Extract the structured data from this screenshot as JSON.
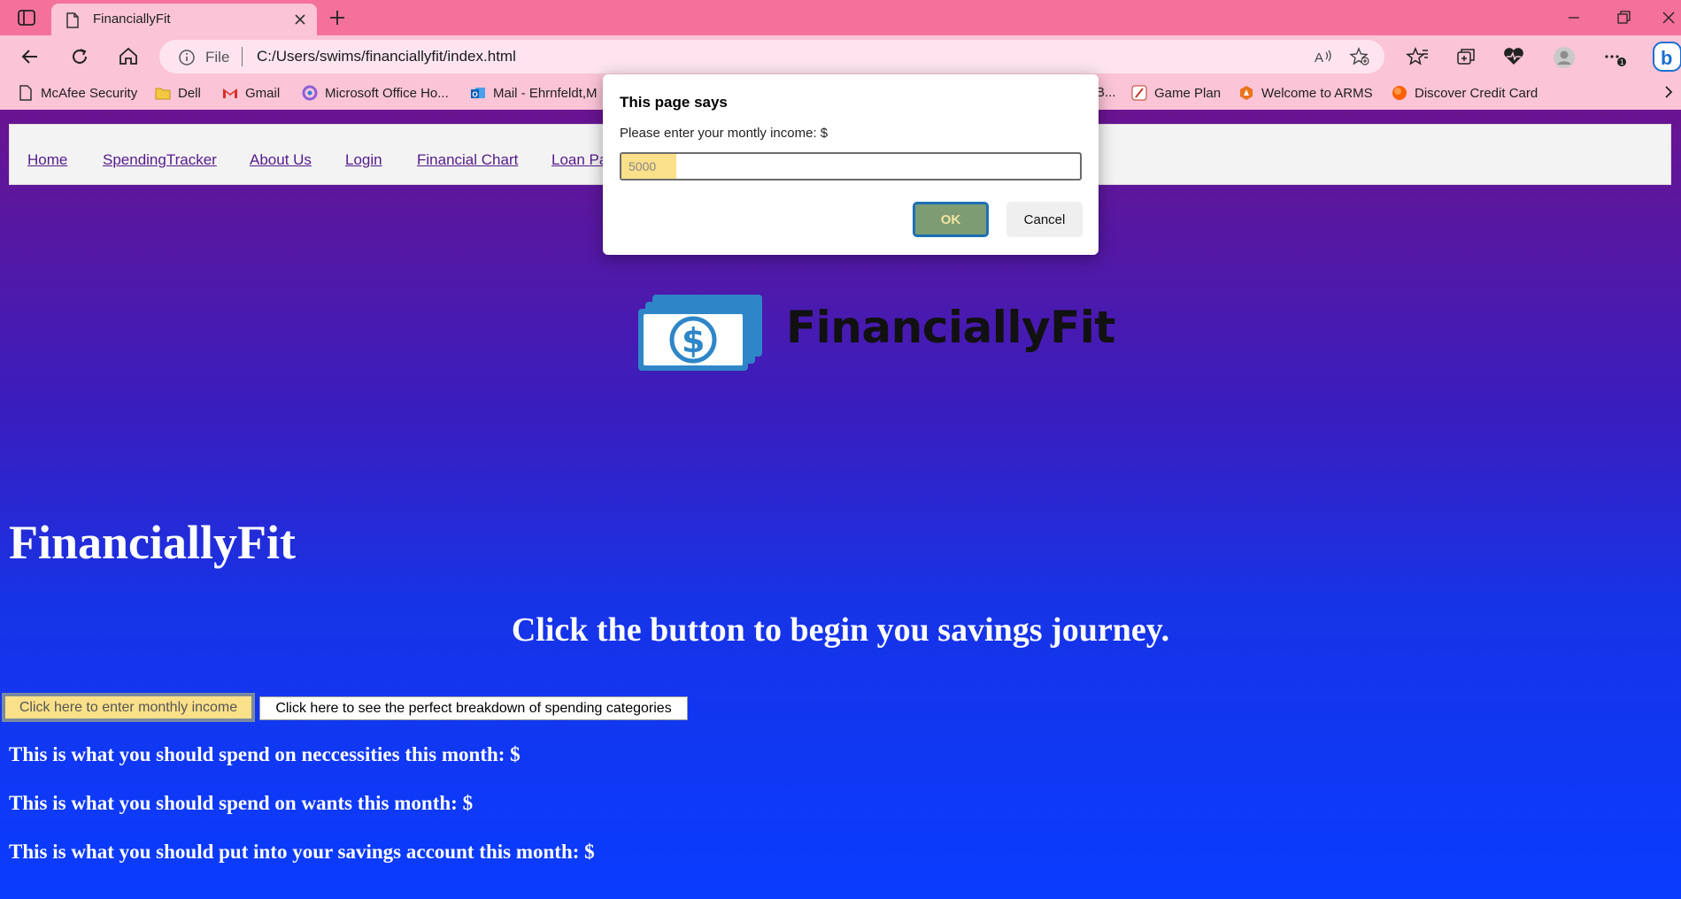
{
  "browser": {
    "tab_title": "FinanciallyFit",
    "new_tab_symbol": "+",
    "address": {
      "scheme_label": "File",
      "url": "C:/Users/swims/financiallyfit/index.html"
    },
    "bookmarks": [
      {
        "label": "McAfee Security",
        "icon": "document-icon"
      },
      {
        "label": "Dell",
        "icon": "folder-icon"
      },
      {
        "label": "Gmail",
        "icon": "gmail-icon"
      },
      {
        "label": "Microsoft Office Ho...",
        "icon": "office-icon"
      },
      {
        "label": "Mail - Ehrnfeldt,M",
        "icon": "outlook-icon"
      },
      {
        "label": "B...",
        "icon": ""
      },
      {
        "label": "Game Plan",
        "icon": "game-plan-icon"
      },
      {
        "label": "Welcome to ARMS",
        "icon": "arms-icon"
      },
      {
        "label": "Discover Credit Card",
        "icon": "discover-icon"
      }
    ]
  },
  "site": {
    "nav": [
      "Home",
      "SpendingTracker",
      "About Us",
      "Login",
      "Financial Chart",
      "Loan Pa"
    ],
    "logo_text": "FinanciallyFit",
    "heading": "FinanciallyFit",
    "subheading": "Click the button to begin you savings journey.",
    "buttons": {
      "income": "Click here to enter monthly income",
      "breakdown": "Click here to see the perfect breakdown of spending categories"
    },
    "results": [
      "This is what you should spend on neccessities this month: $",
      "This is what you should spend on wants this month: $",
      "This is what you should put into your savings account this month: $"
    ]
  },
  "dialog": {
    "title": "This page says",
    "message": "Please enter your montly income: $",
    "input_value": "5000",
    "ok_label": "OK",
    "cancel_label": "Cancel"
  },
  "colors": {
    "tabbar": "#f4719c",
    "toolbar": "#fbc4d7",
    "page_gradient_top": "#6a1490",
    "page_gradient_bottom": "#0a3cff",
    "highlight": "#fbe08a"
  }
}
